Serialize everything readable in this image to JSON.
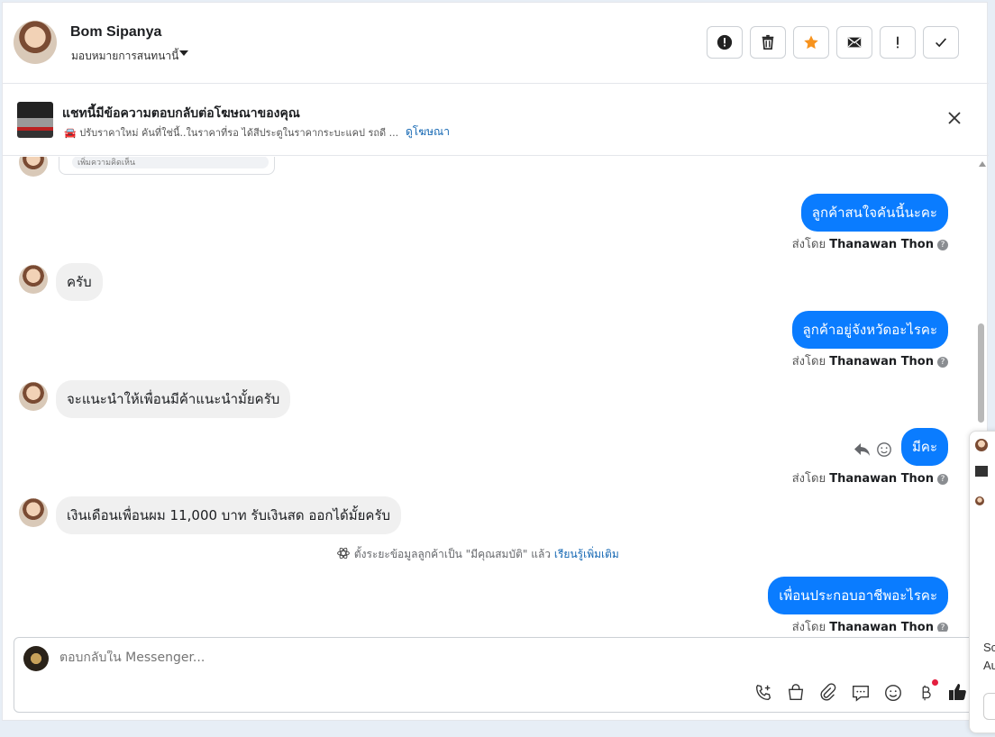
{
  "header": {
    "name": "Bom Sipanya",
    "assign_label": "มอบหมายการสนทนานี้",
    "buttons": [
      "spam-button",
      "delete-button",
      "star-button",
      "mark-unread-button",
      "follow-up-button",
      "done-button"
    ]
  },
  "ad_banner": {
    "title": "แชทนี้มีข้อความตอบกลับต่อโฆษณาของคุณ",
    "description": "🚘 ปรับราคาใหม่ คันที่ใช่นี้..ในราคาที่รอ ได้สีประตูในราคากระบะแคป รถดี ...",
    "link_label": "ดูโฆษณา"
  },
  "conversation": {
    "partial_card_text": "เพิ่มความคิดเห็น",
    "messages": [
      {
        "dir": "out",
        "text": "ลูกค้าสนใจคันนี้นะคะ"
      },
      {
        "dir": "in",
        "text": "ครับ"
      },
      {
        "dir": "out",
        "text": "ลูกค้าอยู่จังหวัดอะไรคะ"
      },
      {
        "dir": "in",
        "text": "จะแนะนำให้เพื่อนมีค้าแนะนำมั้ยครับ"
      },
      {
        "dir": "out",
        "text": "มีคะ"
      },
      {
        "dir": "in",
        "text": "เงินเดือนเพื่อนผม 11,000 บาท รับเงินสด ออกได้มั้ยครับ"
      },
      {
        "dir": "out",
        "text": "เพื่อนประกอบอาชีพอะไรคะ"
      }
    ],
    "sent_by_prefix": "ส่งโดย",
    "sent_by_name": "Thanawan Thon",
    "notice_text": "ตั้งระยะข้อมูลลูกค้าเป็น \"มีคุณสมบัติ\" แล้ว",
    "notice_link": "เรียนรู้เพิ่มเติม"
  },
  "composer": {
    "placeholder": "ตอบกลับใน Messenger..."
  },
  "side_popup": {
    "text_line1": "Sc",
    "text_line2": "Au"
  },
  "colors": {
    "outgoing_bubble": "#0a7cff",
    "incoming_bubble": "#f0f0f0",
    "link": "#1467b3",
    "star": "#f7931e"
  }
}
